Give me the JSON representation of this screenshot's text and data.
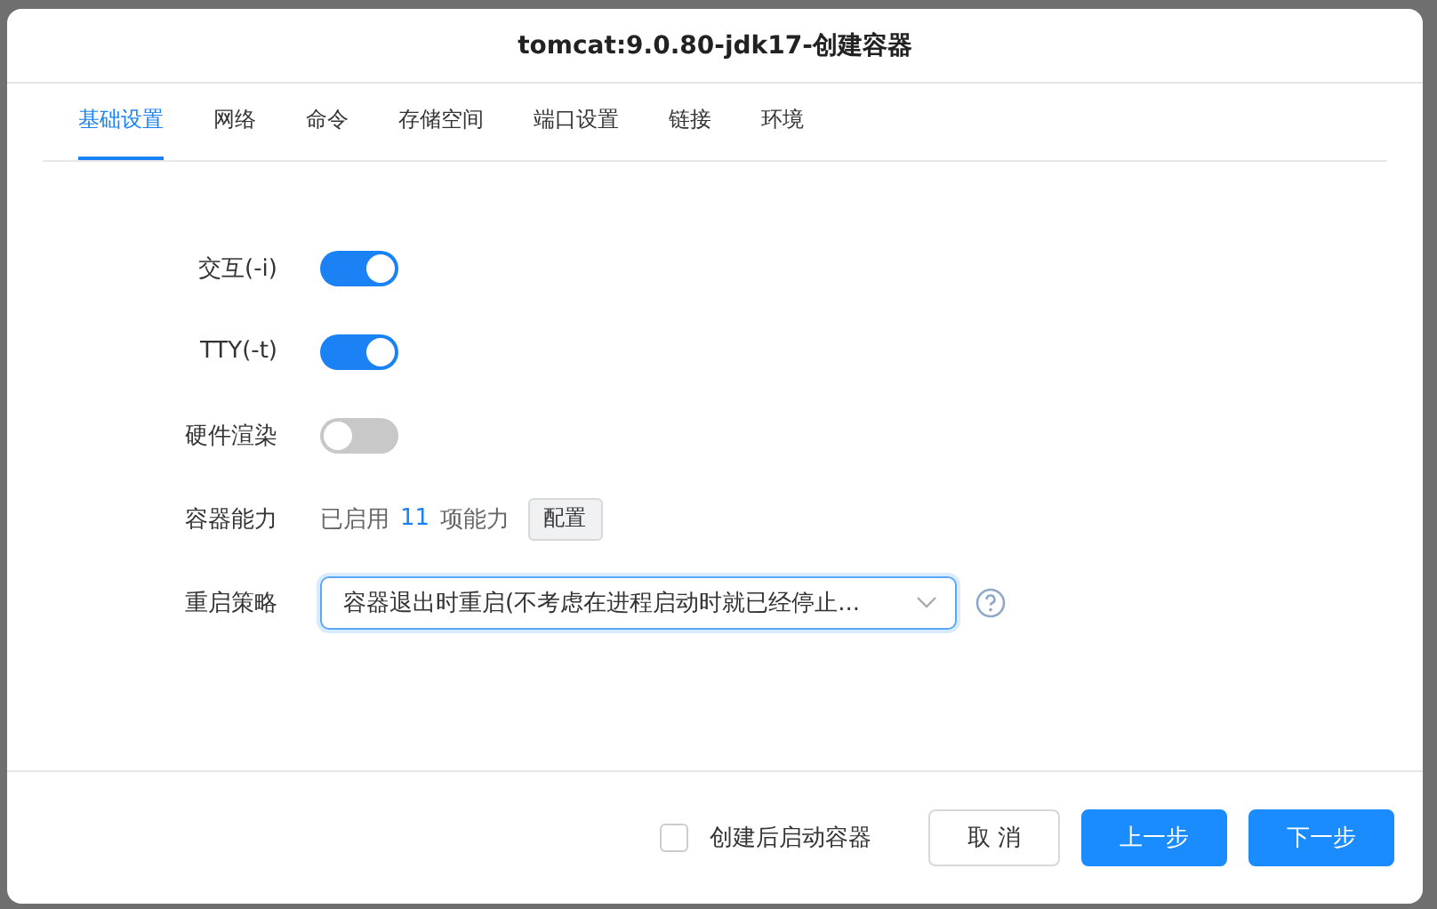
{
  "dialog": {
    "title": "tomcat:9.0.80-jdk17-创建容器"
  },
  "tabs": [
    {
      "label": "基础设置",
      "selected": true
    },
    {
      "label": "网络",
      "selected": false
    },
    {
      "label": "命令",
      "selected": false
    },
    {
      "label": "存储空间",
      "selected": false
    },
    {
      "label": "端口设置",
      "selected": false
    },
    {
      "label": "链接",
      "selected": false
    },
    {
      "label": "环境",
      "selected": false
    }
  ],
  "form": [
    {
      "kind": "switch",
      "label": "交互(-i)",
      "on": true
    },
    {
      "kind": "switch",
      "label": "TTY(-t)",
      "on": true
    },
    {
      "kind": "switch",
      "label": "硬件渲染",
      "on": false
    },
    {
      "kind": "capability",
      "label": "容器能力",
      "prefix": "已启用",
      "count": "11",
      "suffix": "项能力",
      "button": "配置"
    },
    {
      "kind": "select",
      "label": "重启策略",
      "value": "容器退出时重启(不考虑在进程启动时就已经停止..."
    }
  ],
  "footer": {
    "checkbox": {
      "label": "创建后启动容器",
      "checked": false
    },
    "buttons": [
      {
        "label": "取 消",
        "kind": "secondary"
      },
      {
        "label": "上一步",
        "kind": "primary"
      },
      {
        "label": "下一步",
        "kind": "primary"
      }
    ]
  }
}
